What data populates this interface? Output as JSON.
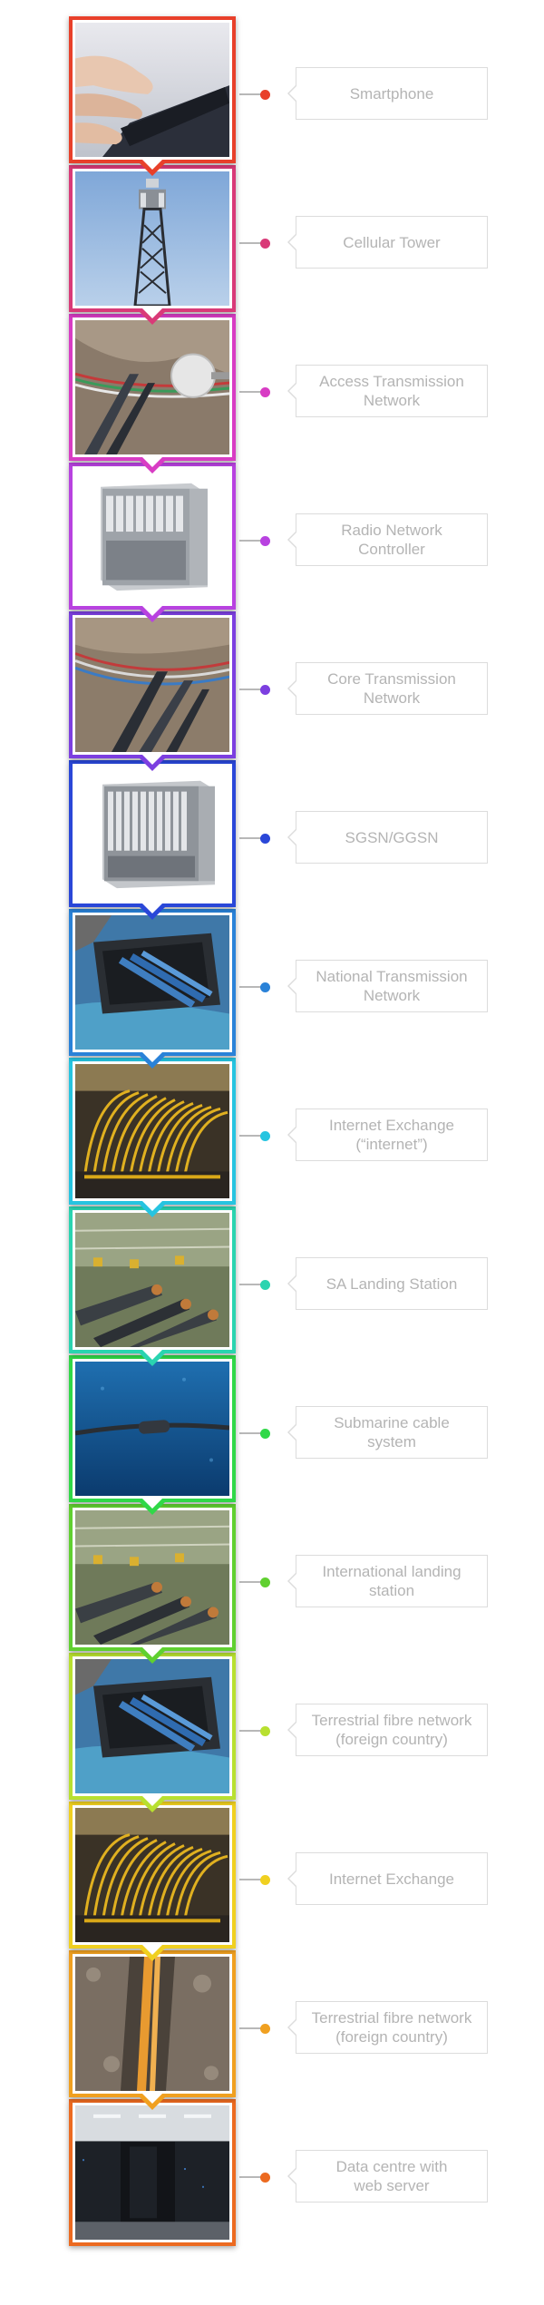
{
  "pipeline": {
    "stages": [
      {
        "label": "Smartphone",
        "color": "#e8402a",
        "photo": "hand-holding-smartphone"
      },
      {
        "label": "Cellular Tower",
        "color": "#d93a78",
        "photo": "cellular-tower-against-sky"
      },
      {
        "label": "Access Transmission\nNetwork",
        "color": "#d83cc4",
        "photo": "fibre-cables-and-dish"
      },
      {
        "label": "Radio Network\nController",
        "color": "#b842e0",
        "photo": "rack-equipment-cabinet"
      },
      {
        "label": "Core Transmission\nNetwork",
        "color": "#7c3fe0",
        "photo": "fibre-cables-trench"
      },
      {
        "label": "SGSN/GGSN",
        "color": "#2a47d8",
        "photo": "server-chassis"
      },
      {
        "label": "National Transmission\nNetwork",
        "color": "#2a82d8",
        "photo": "ducts-in-pit"
      },
      {
        "label": "Internet Exchange\n(“internet”)",
        "color": "#26c4e0",
        "photo": "yellow-patch-cables"
      },
      {
        "label": "SA Landing Station",
        "color": "#2ad4b0",
        "photo": "landing-station-cables"
      },
      {
        "label": "Submarine cable\nsystem",
        "color": "#30d848",
        "photo": "underwater-cable"
      },
      {
        "label": "International landing\nstation",
        "color": "#60d030",
        "photo": "landing-station-cables"
      },
      {
        "label": "Terrestrial fibre network\n(foreign country)",
        "color": "#b8e030",
        "photo": "ducts-in-pit"
      },
      {
        "label": "Internet Exchange",
        "color": "#f0d020",
        "photo": "yellow-patch-cables"
      },
      {
        "label": "Terrestrial fibre network\n(foreign country)",
        "color": "#f0a020",
        "photo": "orange-duct-trench"
      },
      {
        "label": "Data centre with\nweb server",
        "color": "#ec6a20",
        "photo": "data-centre-aisle"
      }
    ]
  }
}
